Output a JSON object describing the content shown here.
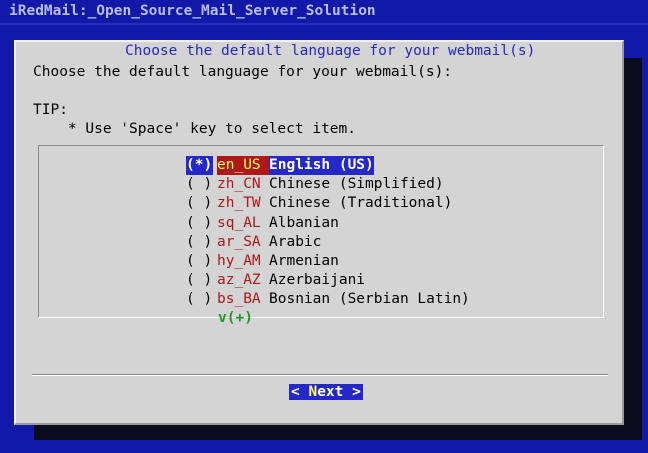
{
  "window": {
    "title": "iRedMail:_Open_Source_Mail_Server_Solution"
  },
  "dialog": {
    "title": "Choose the default language for your webmail(s)",
    "prompt": "Choose the default language for your webmail(s):",
    "tip_label": "TIP:",
    "tip_text": "    * Use 'Space' key to select item.",
    "more_indicator": "v(+)",
    "next_button": {
      "left": "< ",
      "hotkey": "N",
      "rest": "ext",
      "right": " >"
    }
  },
  "languages": [
    {
      "radio": "(*)",
      "code": "en_US",
      "name": "English (US)",
      "selected": true
    },
    {
      "radio": "( )",
      "code": "zh_CN",
      "name": "Chinese (Simplified)",
      "selected": false
    },
    {
      "radio": "( )",
      "code": "zh_TW",
      "name": "Chinese (Traditional)",
      "selected": false
    },
    {
      "radio": "( )",
      "code": "sq_AL",
      "name": "Albanian",
      "selected": false
    },
    {
      "radio": "( )",
      "code": "ar_SA",
      "name": "Arabic",
      "selected": false
    },
    {
      "radio": "( )",
      "code": "hy_AM",
      "name": "Armenian",
      "selected": false
    },
    {
      "radio": "( )",
      "code": "az_AZ",
      "name": "Azerbaijani",
      "selected": false
    },
    {
      "radio": "( )",
      "code": "bs_BA",
      "name": "Bosnian (Serbian Latin)",
      "selected": false
    }
  ],
  "colors": {
    "screen_background": "#1218a8",
    "dialog_background": "#d4d4d4",
    "highlight": "#2428c8",
    "code_text": "#b01818",
    "hotkey": "#ffff55",
    "more_indicator": "#1e9a1e"
  }
}
